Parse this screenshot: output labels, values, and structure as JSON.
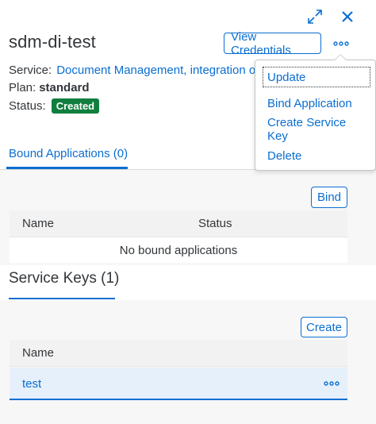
{
  "header": {
    "title": "sdm-di-test",
    "view_credentials_label": "View Credentials",
    "expand_icon": "expand-icon",
    "close_icon": "close-icon",
    "overflow_icon": "more-icon"
  },
  "info": {
    "service_label": "Service:",
    "service_value": "Document Management, integration option",
    "plan_label": "Plan:",
    "plan_value": "standard",
    "status_label": "Status:",
    "status_value": "Created"
  },
  "tabs": [
    {
      "label": "Bound Applications (0)",
      "selected": true
    }
  ],
  "bound_applications": {
    "bind_label": "Bind",
    "columns": [
      "Name",
      "Status"
    ],
    "empty_text": "No bound applications"
  },
  "service_keys": {
    "title": "Service Keys (1)",
    "create_label": "Create",
    "columns": [
      "Name"
    ],
    "rows": [
      {
        "name": "test"
      }
    ]
  },
  "menu": {
    "items": [
      {
        "label": "Update"
      },
      {
        "label": "Bind Application"
      },
      {
        "label": "Create Service Key"
      },
      {
        "label": "Delete"
      }
    ]
  },
  "colors": {
    "accent": "#0a6ed1",
    "success": "#107e3e",
    "text": "#32363a"
  }
}
